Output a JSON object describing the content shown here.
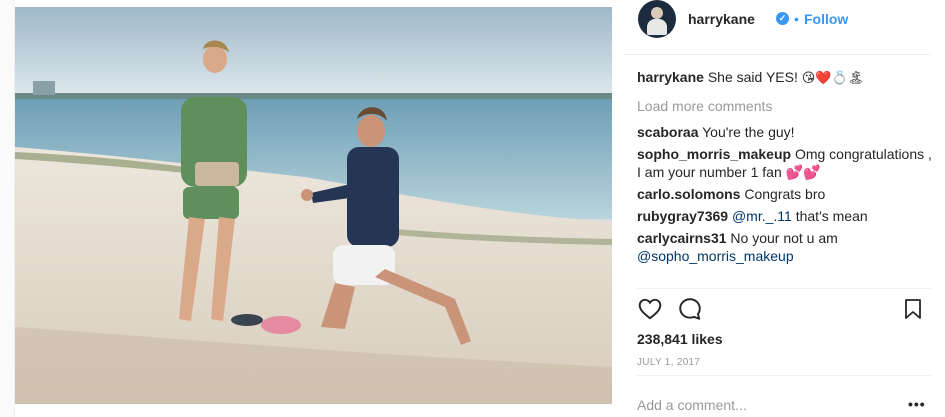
{
  "post": {
    "username": "harrykane",
    "verified_icon": "verified-badge-icon",
    "follow_separator": "•",
    "follow_label": "Follow",
    "caption_user": "harrykane",
    "caption_text": "She said YES!",
    "caption_emoji": "😘❤️💍🏝",
    "load_more_label": "Load more comments",
    "comments": [
      {
        "user": "scaboraa",
        "text": "You're the guy!"
      },
      {
        "user": "sopho_morris_makeup",
        "text": "Omg congratulations , I am your number 1 fan 💕💕"
      },
      {
        "user": "carlo.solomons",
        "text": "Congrats bro"
      },
      {
        "user": "rubygray7369",
        "mention": "@mr._.11",
        "text": "that's mean"
      },
      {
        "user": "carlycairns31",
        "text": "No your not u am",
        "mention": "@sopho_morris_makeup"
      }
    ],
    "likes": "238,841 likes",
    "date": "JULY 1, 2017",
    "add_comment_placeholder": "Add a comment...",
    "more_options_label": "•••"
  },
  "icons": {
    "like": "heart-icon",
    "comment": "comment-bubble-icon",
    "save": "bookmark-icon",
    "more": "more-options-icon"
  },
  "colors": {
    "accent": "#3897f0",
    "text": "#262626",
    "muted": "#999999",
    "mention": "#003569"
  }
}
